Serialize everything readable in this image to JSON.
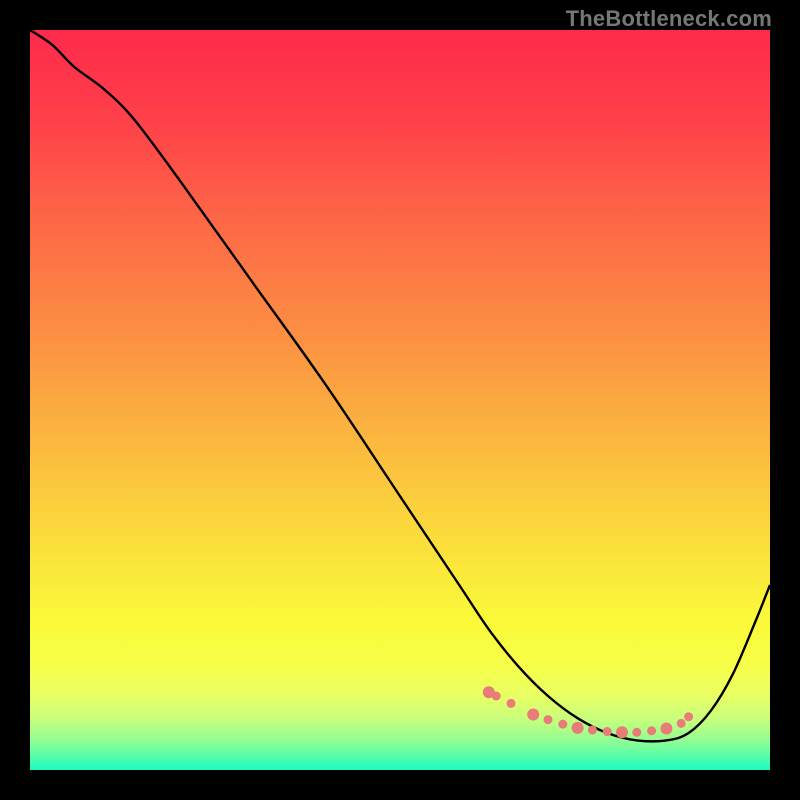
{
  "watermark": "TheBottleneck.com",
  "colors": {
    "frame": "#000000",
    "curve": "#000000",
    "dots": "#E77C78",
    "gradient_stops": [
      {
        "offset": 0.0,
        "color": "#FE2A4B"
      },
      {
        "offset": 0.12,
        "color": "#FE4049"
      },
      {
        "offset": 0.25,
        "color": "#FD6547"
      },
      {
        "offset": 0.4,
        "color": "#FC8C43"
      },
      {
        "offset": 0.55,
        "color": "#FBB63F"
      },
      {
        "offset": 0.7,
        "color": "#FBE03B"
      },
      {
        "offset": 0.8,
        "color": "#FAFA39"
      },
      {
        "offset": 0.86,
        "color": "#F7FE4A"
      },
      {
        "offset": 0.9,
        "color": "#E8FE63"
      },
      {
        "offset": 0.93,
        "color": "#C9FE7C"
      },
      {
        "offset": 0.96,
        "color": "#93FD92"
      },
      {
        "offset": 0.98,
        "color": "#5AFDA8"
      },
      {
        "offset": 1.0,
        "color": "#1CFCBF"
      }
    ]
  },
  "chart_data": {
    "type": "line",
    "title": "",
    "xlabel": "",
    "ylabel": "",
    "xlim": [
      0,
      100
    ],
    "ylim": [
      0,
      100
    ],
    "series": [
      {
        "name": "curve",
        "x": [
          0,
          3,
          6,
          10,
          14,
          20,
          30,
          40,
          50,
          58,
          62,
          66,
          70,
          74,
          78,
          82,
          86,
          89,
          92,
          95,
          98,
          100
        ],
        "y": [
          100,
          98,
          95,
          92,
          88,
          80,
          66,
          52,
          37,
          25,
          19,
          14,
          10,
          7,
          5,
          4,
          4,
          5,
          8,
          13,
          20,
          25
        ]
      }
    ],
    "markers": {
      "name": "cluster-dots",
      "x": [
        62,
        63,
        65,
        68,
        70,
        72,
        74,
        76,
        78,
        80,
        82,
        84,
        86,
        88,
        89
      ],
      "y": [
        10.5,
        10,
        9,
        7.5,
        6.8,
        6.2,
        5.7,
        5.4,
        5.2,
        5.1,
        5.1,
        5.3,
        5.6,
        6.3,
        7.2
      ]
    }
  }
}
